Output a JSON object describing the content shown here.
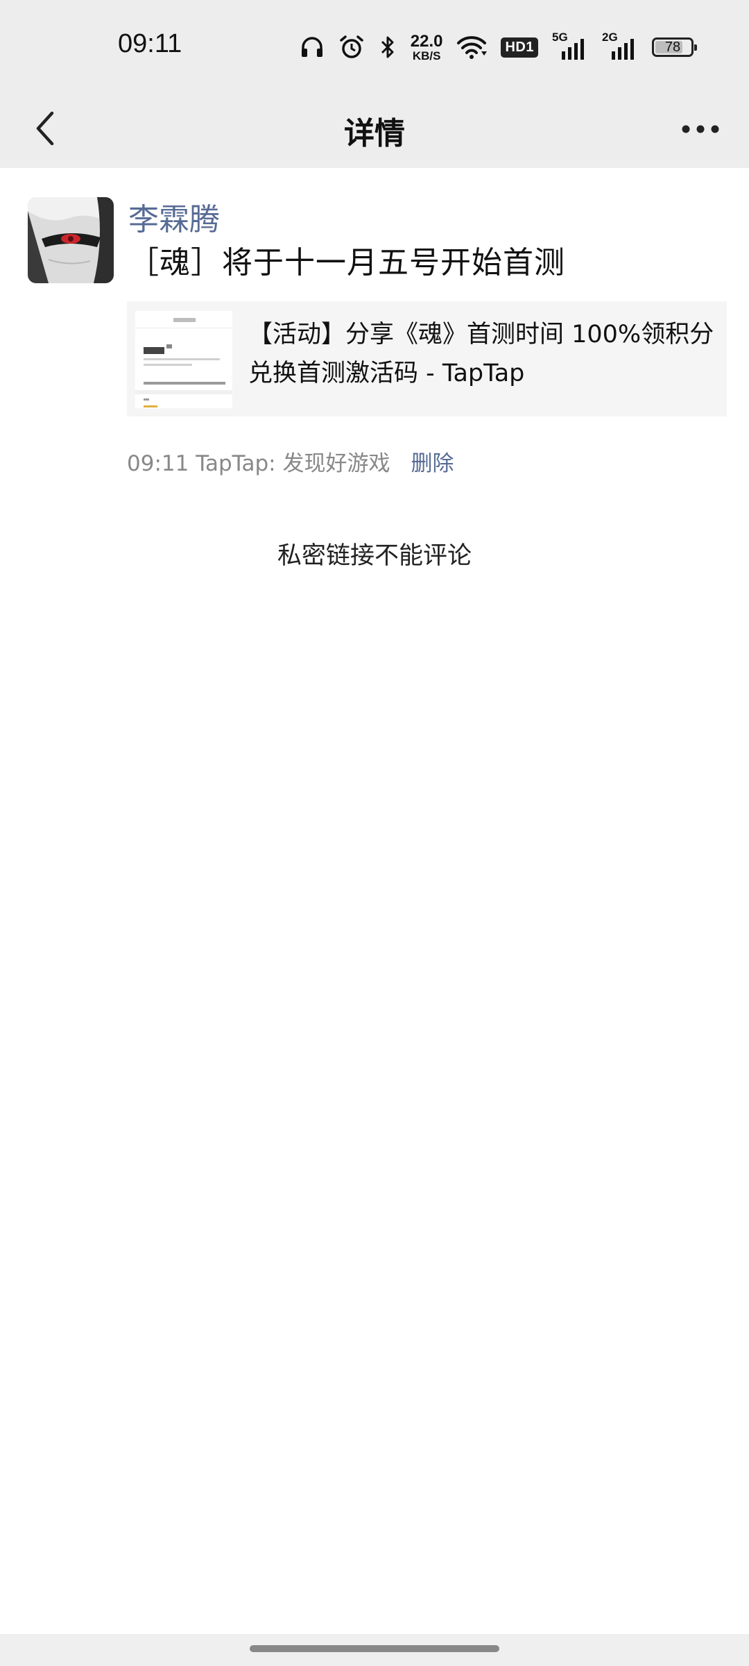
{
  "status_bar": {
    "time": "09:11",
    "net_speed_value": "22.0",
    "net_speed_unit": "KB/S",
    "hd_label": "HD1",
    "signal_1_label": "5G",
    "signal_2_label": "2G",
    "battery_percent": "78",
    "battery_level": 0.78,
    "icons": [
      "headphones-icon",
      "alarm-icon",
      "bluetooth-icon",
      "wifi-icon"
    ]
  },
  "nav": {
    "title": "详情",
    "back_icon": "chevron-left-icon",
    "more_icon": "more-dots-icon"
  },
  "post": {
    "author": "李霖腾",
    "text": "［魂］将于十一月五号开始首测",
    "link_card": {
      "title": "【活动】分享《魂》首测时间 100%领积分兑换首测激活码 - TapTap"
    },
    "time": "09:11",
    "source": "TapTap: 发现好游戏",
    "delete_label": "删除"
  },
  "notice": "私密链接不能评论",
  "colors": {
    "link": "#576b95",
    "bar_bg": "#ededed",
    "card_bg": "#f5f5f5"
  }
}
